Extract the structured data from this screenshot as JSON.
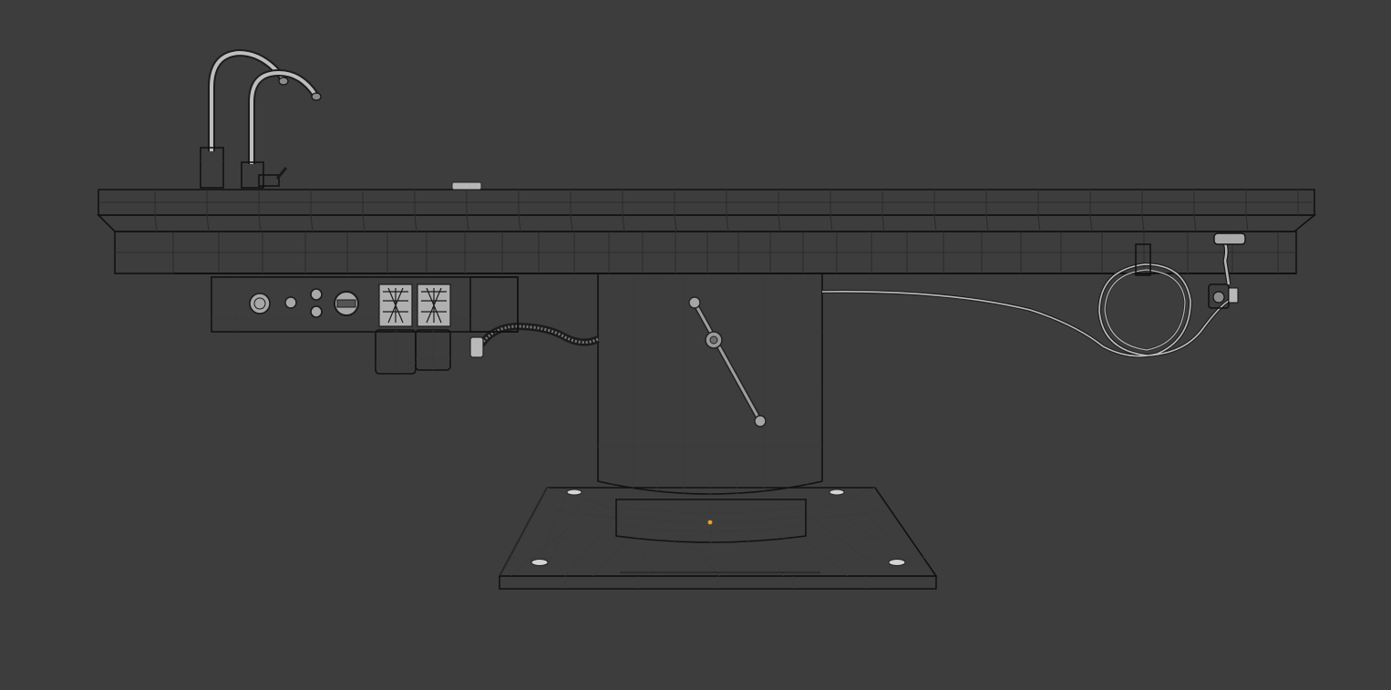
{
  "viewport": {
    "background_color": "#3d3d3d",
    "mesh_color": "#c8c8c8",
    "mesh_shadow_color": "#a9a9a9",
    "wire_color": "#2a2a2a",
    "origin_point_color": "#f29b2c"
  },
  "objects": [
    "gooseneck-faucet-left",
    "gooseneck-faucet-right",
    "table-top",
    "control-panel",
    "foot-pedals",
    "corrugated-hose",
    "pedestal-column",
    "lever-handle",
    "base-plate",
    "hand-sprayer",
    "coiled-sprayer-hose"
  ]
}
